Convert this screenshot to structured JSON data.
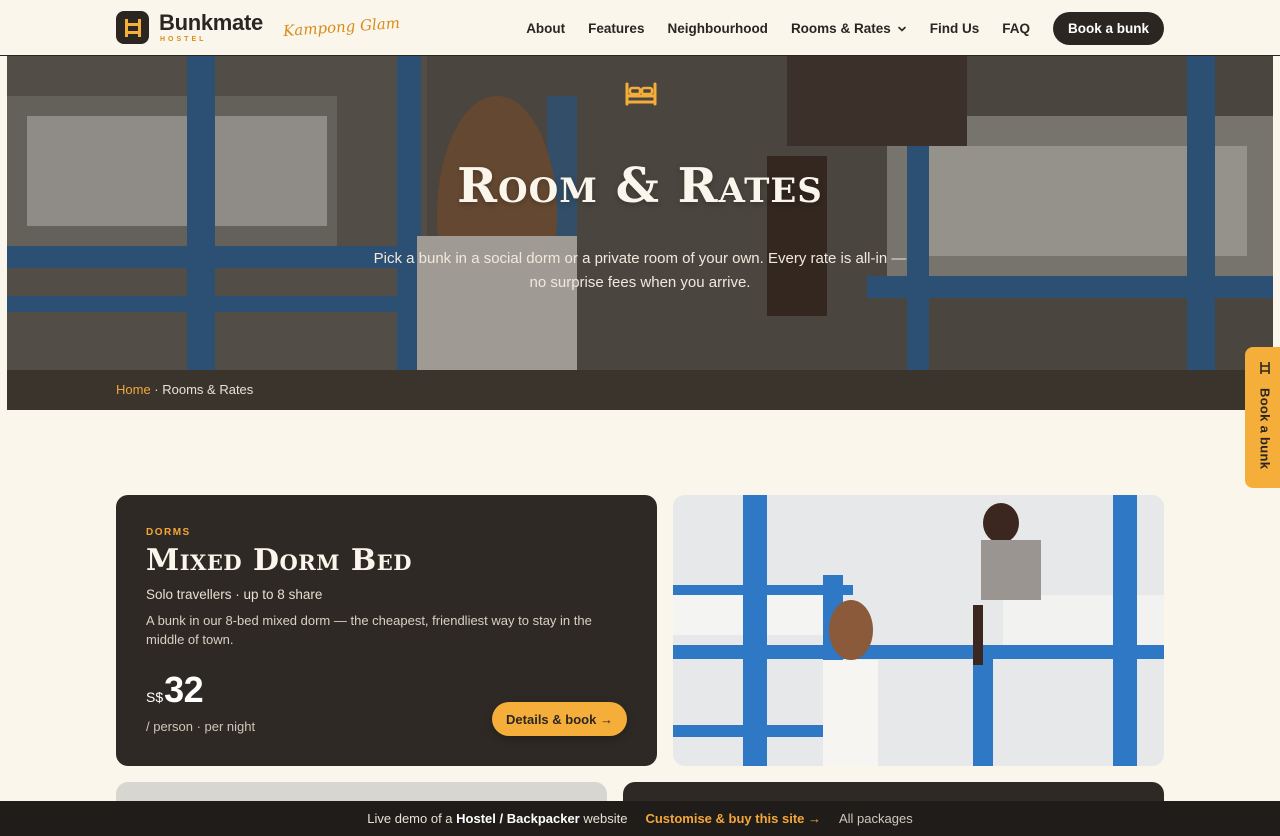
{
  "brand": {
    "name": "Bunkmate",
    "sub": "HOSTEL",
    "tagline": "Kampong Glam"
  },
  "nav": {
    "about": "About",
    "features": "Features",
    "neighbourhood": "Neighbourhood",
    "rooms": "Rooms & Rates",
    "find_us": "Find Us",
    "faq": "FAQ",
    "cta": "Book a bunk"
  },
  "hero": {
    "title": "Room & Rates",
    "subtitle": "Pick a bunk in a social dorm or a private room of your own. Every rate is all-in — no surprise fees when you arrive."
  },
  "breadcrumb": {
    "home": "Home",
    "sep": " · ",
    "current": "Rooms & Rates"
  },
  "side_tab": {
    "label": "Book a bunk"
  },
  "room": {
    "eyebrow": "DORMS",
    "title": "Mixed Dorm Bed",
    "meta": "Solo travellers · up to 8 share",
    "description": "A bunk in our 8-bed mixed dorm — the cheapest, friendliest way to stay in the middle of town.",
    "currency": "S$",
    "price": "32",
    "unit": "/ person · per night",
    "button": "Details & book →"
  },
  "demo_bar": {
    "prefix": "Live demo of a ",
    "product": "Hostel / Backpacker",
    "suffix": " website",
    "cta": "Customise & buy this site →",
    "packages": "All packages"
  },
  "colors": {
    "accent": "#f6ae3b",
    "dark": "#2e2925",
    "cream": "#faf6ec"
  }
}
